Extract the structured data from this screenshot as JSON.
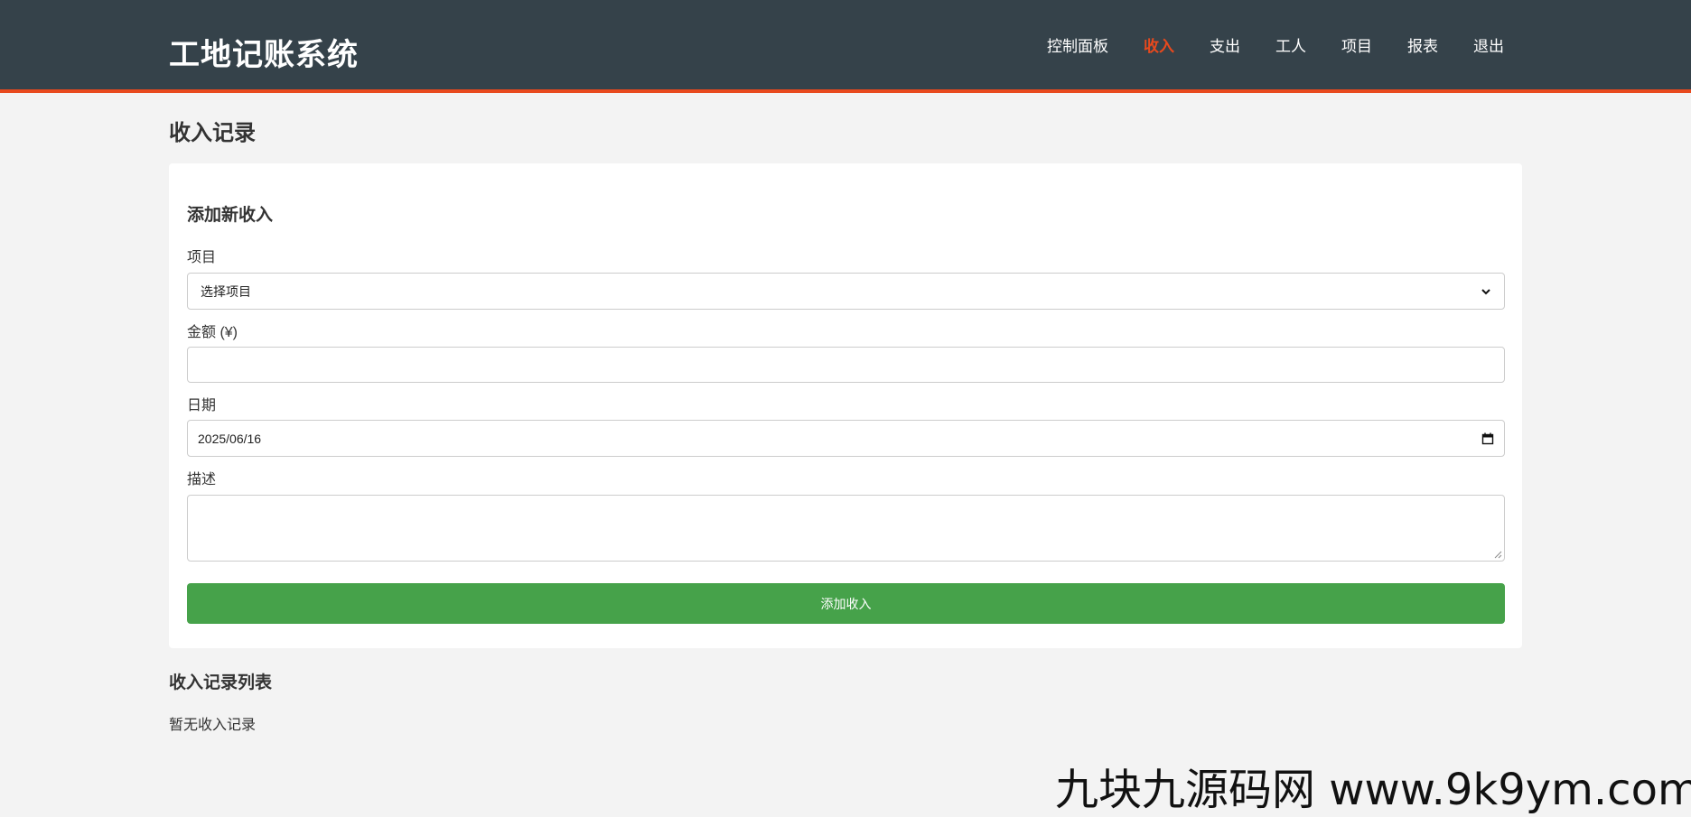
{
  "header": {
    "brand": "工地记账系统",
    "nav": [
      {
        "label": "控制面板",
        "active": false
      },
      {
        "label": "收入",
        "active": true
      },
      {
        "label": "支出",
        "active": false
      },
      {
        "label": "工人",
        "active": false
      },
      {
        "label": "项目",
        "active": false
      },
      {
        "label": "报表",
        "active": false
      },
      {
        "label": "退出",
        "active": false
      }
    ]
  },
  "page": {
    "title": "收入记录"
  },
  "form": {
    "title": "添加新收入",
    "project_label": "项目",
    "project_selected": "选择项目",
    "amount_label": "金额 (¥)",
    "amount_value": "",
    "date_label": "日期",
    "date_value": "2025/06/16",
    "description_label": "描述",
    "description_value": "",
    "submit_label": "添加收入"
  },
  "list": {
    "title": "收入记录列表",
    "empty_text": "暂无收入记录"
  },
  "watermark": "九块九源码网 www.9k9ym.com",
  "colors": {
    "header_bg": "#35424a",
    "accent": "#e8491d",
    "button": "#46a24a",
    "page_bg": "#f3f3f3"
  }
}
